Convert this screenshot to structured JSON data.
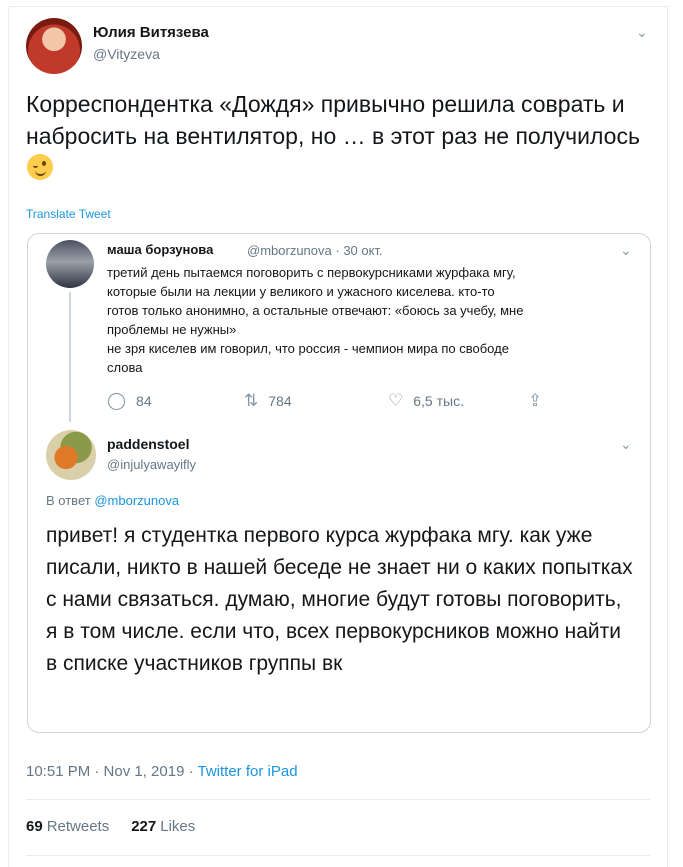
{
  "author": {
    "name": "Юлия Витязева",
    "handle": "@Vityzeva"
  },
  "tweet": {
    "text": "Корреспондентка «Дождя» привычно решила соврать и набросить на вентилятор, но … в этот раз не получилось",
    "translate_label": "Translate Tweet"
  },
  "quoted_tweet": {
    "name": "маша борзунова",
    "handle": "@mborzunova",
    "date": "· 30 окт.",
    "text_lines": [
      "третий день пытаемся поговорить с первокурсниками журфака мгу,",
      "которые были на лекции у великого и ужасного киселева. кто-то",
      "готов только анонимно, а  остальные отвечают: «боюсь за учебу, мне",
      "проблемы не нужны»",
      "не зря киселев им говорил, что россия - чемпион мира по свободе",
      "слова"
    ],
    "replies": "84",
    "retweets": "784",
    "likes": "6,5 тыс."
  },
  "reply_tweet": {
    "name": "paddenstoel",
    "handle": "@injulyawayifly",
    "reply_prefix": "В ответ",
    "reply_to": "@mborzunova",
    "text": "привет! я студентка первого курса журфака мгу. как уже писали, никто в нашей беседе не знает ни о каких попытках с нами связаться. думаю, многие будут готовы поговорить, я в том числе. если что, всех первокурсников можно найти в списке участников группы вк"
  },
  "meta": {
    "time": "10:51 PM · Nov 1, 2019 ·",
    "source": "Twitter for iPad"
  },
  "stats": {
    "retweets_count": "69",
    "retweets_label": "Retweets",
    "likes_count": "227",
    "likes_label": "Likes"
  },
  "icons": {
    "chevron": "chevron-down-icon",
    "reply": "reply-icon",
    "retweet": "retweet-icon",
    "like": "heart-icon",
    "share": "share-icon",
    "emoji": "winking-face-emoji"
  },
  "colors": {
    "link": "#1b95e0",
    "muted": "#657786",
    "border": "#ccd6dd"
  }
}
